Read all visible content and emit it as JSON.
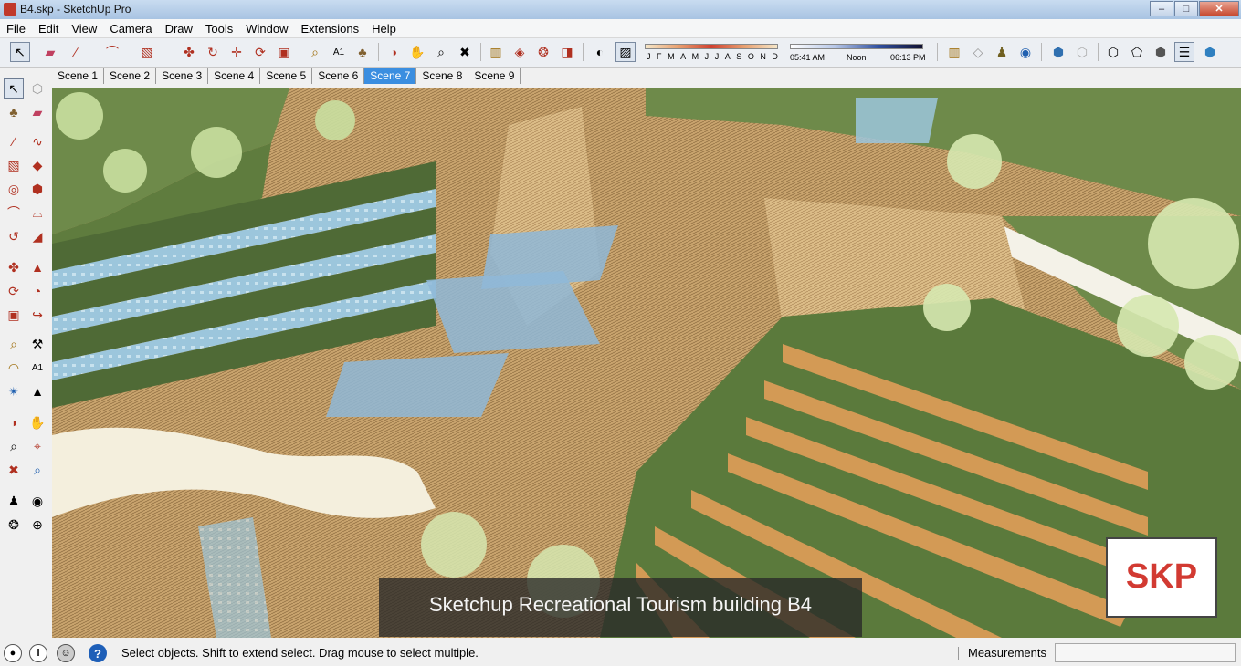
{
  "window": {
    "title": "B4.skp - SketchUp Pro",
    "minimize": "–",
    "maximize": "□",
    "close": "✕"
  },
  "menu": [
    "File",
    "Edit",
    "View",
    "Camera",
    "Draw",
    "Tools",
    "Window",
    "Extensions",
    "Help"
  ],
  "shadow_settings": {
    "months": [
      "J",
      "F",
      "M",
      "A",
      "M",
      "J",
      "J",
      "A",
      "S",
      "O",
      "N",
      "D"
    ],
    "sunrise": "05:41 AM",
    "noon": "Noon",
    "sunset": "06:13 PM"
  },
  "scenes": {
    "tabs": [
      "Scene 1",
      "Scene 2",
      "Scene 3",
      "Scene 4",
      "Scene 5",
      "Scene 6",
      "Scene 7",
      "Scene 8",
      "Scene 9"
    ],
    "selected": "Scene 7"
  },
  "viewport": {
    "caption": "Sketchup Recreational Tourism building B4",
    "logo": "SKP"
  },
  "status": {
    "hint": "Select objects. Shift to extend select. Drag mouse to select multiple.",
    "measurements_label": "Measurements",
    "measurements_value": ""
  },
  "icons": {
    "toolbar": [
      "select-icon",
      "eraser-icon",
      "line-icon",
      "arc-icon",
      "rectangle-icon",
      "move-icon",
      "push-pull-icon",
      "move-icon",
      "rotate-icon",
      "scale-icon",
      "tape-measure-icon",
      "text-icon",
      "paint-bucket-icon",
      "orbit-icon",
      "pan-icon",
      "zoom-icon",
      "zoom-extents-icon",
      "warehouse-icon",
      "components-icon",
      "extension-icon",
      "send-icon",
      "shadow-icon",
      "fog-icon"
    ],
    "status": [
      "geo-location-icon",
      "credits-icon",
      "user-icon",
      "help-icon"
    ]
  }
}
